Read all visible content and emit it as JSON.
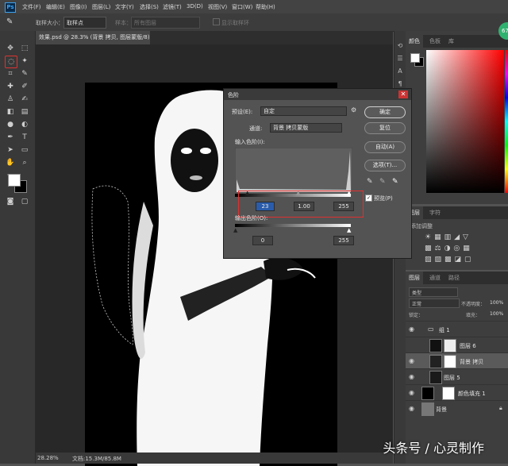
{
  "menu": [
    "文件(F)",
    "编辑(E)",
    "图像(I)",
    "图层(L)",
    "文字(Y)",
    "选择(S)",
    "滤镜(T)",
    "3D(D)",
    "视图(V)",
    "窗口(W)",
    "帮助(H)"
  ],
  "options": {
    "sample_size_label": "取样大小：",
    "sample_size_value": "取样点",
    "sample_label": "样本：",
    "sample_value": "所有图层",
    "show_ring": "显示取样环"
  },
  "doc_tab": "效果.psd @ 28.3% (背景 拷贝, 图层蒙版/8) *",
  "status": {
    "zoom": "28.28%",
    "doc": "文档:15.3M/85.8M"
  },
  "right_panels": {
    "color_tabs": [
      "颜色",
      "色板",
      "库"
    ],
    "mid_tabs": [
      "图层",
      "字符"
    ],
    "mid_label": "添加调整",
    "layers_tabs": [
      "图层",
      "通道",
      "路径"
    ],
    "kind": "类型",
    "blend_mode": "正常",
    "opacity_label": "不透明度：",
    "opacity_value": "100%",
    "lock_label": "锁定：",
    "fill_label": "填充：",
    "fill_value": "100%",
    "layers": [
      "组 1",
      "图层 6",
      "背景 拷贝",
      "图层 5",
      "颜色填充 1",
      "背景"
    ]
  },
  "levels_dialog": {
    "title": "色阶",
    "preset_label": "预设(E):",
    "preset_value": "自定",
    "channel_label": "通道:",
    "channel_value": "背景 拷贝蒙版",
    "input_label": "输入色阶(I):",
    "input_values": [
      "23",
      "1.00",
      "255"
    ],
    "output_label": "输出色阶(O):",
    "output_values": [
      "0",
      "255"
    ],
    "buttons": {
      "ok": "确定",
      "reset": "复位",
      "auto": "自动(A)",
      "options": "选项(T)..."
    },
    "preview_label": "预览(P)"
  },
  "badge": "67",
  "watermark": "头条号 / 心灵制作"
}
